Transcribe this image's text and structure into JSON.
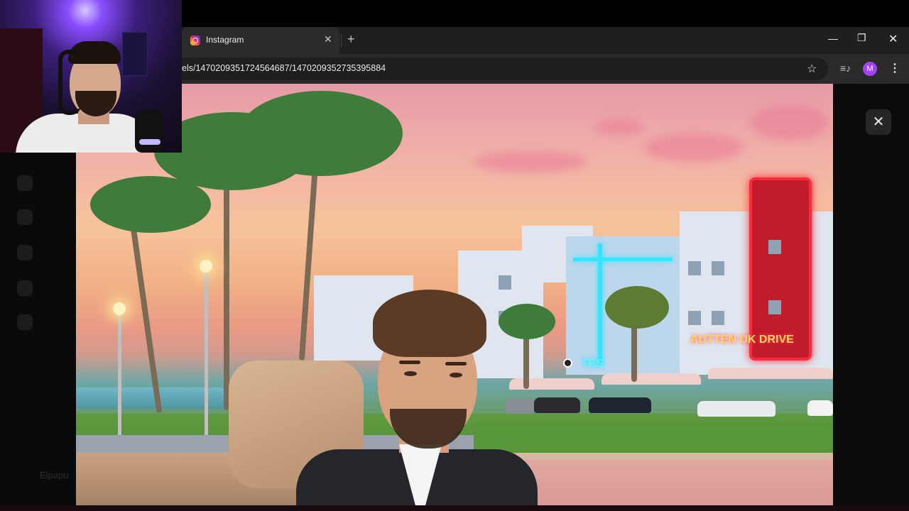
{
  "browser": {
    "tab": {
      "title": "Instagram",
      "icon": "instagram-icon"
    },
    "new_tab_icon": "+",
    "tab_close_icon": "✕",
    "url": "els/147020935172456468​7/1470209352735395884",
    "profile_initial": "M",
    "window_controls": {
      "minimize": "—",
      "restore": "❐",
      "close": "✕"
    }
  },
  "overlay": {
    "close_icon": "✕"
  },
  "background_page": {
    "username": "Elpapu"
  },
  "video": {
    "sign_red": "AUTTEN UK DRIVE",
    "sign_blue": "TES"
  },
  "colors": {
    "chrome_dark": "#1f1f1f",
    "toolbar": "#2b2b2b",
    "profile_accent": "#a142f4",
    "neon_red": "#ff2a3a",
    "neon_blue": "#33e6ff"
  }
}
